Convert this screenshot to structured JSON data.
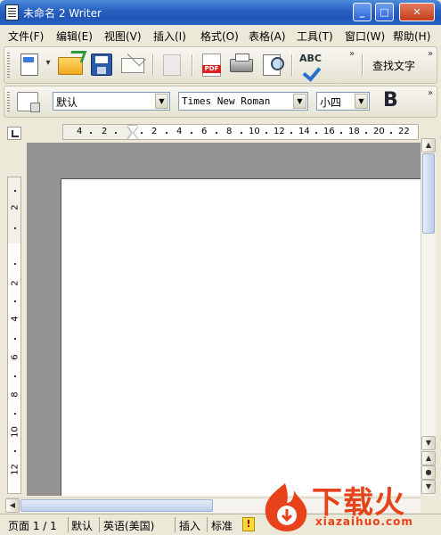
{
  "window": {
    "title": "未命名 2 Writer",
    "minimize": "_",
    "maximize": "□",
    "close": "✕"
  },
  "menu": [
    "文件(F)",
    "编辑(E)",
    "视图(V)",
    "插入(I)",
    "格式(O)",
    "表格(A)",
    "工具(T)",
    "窗口(W)",
    "帮助(H)"
  ],
  "toolbar": {
    "buttons": [
      "new-document-icon",
      "open-folder-icon",
      "save-icon",
      "email-document-icon",
      "edit-document-icon",
      "export-pdf-icon",
      "print-icon",
      "page-preview-icon",
      "spellcheck-icon"
    ],
    "pdf_label": "PDF",
    "spell_label": "ABC",
    "find_text": "查找文字",
    "overflow": "»"
  },
  "format": {
    "style": "默认",
    "font": "Times New Roman",
    "size": "小四",
    "bold": "B"
  },
  "ruler": {
    "h_labels": [
      "4",
      "2",
      "2",
      "4",
      "6",
      "8",
      "10",
      "12",
      "14",
      "16",
      "18",
      "20",
      "22"
    ],
    "v_labels": [
      "2",
      "2",
      "4",
      "6",
      "8",
      "10",
      "12"
    ]
  },
  "status": {
    "page": "页面 1 / 1",
    "style": "默认",
    "language": "英语(美国)",
    "mode": "插入",
    "selection": "标准"
  },
  "watermark": {
    "text": "下载火",
    "url": "xiazaihuo.com",
    "color": "#e8421a"
  }
}
